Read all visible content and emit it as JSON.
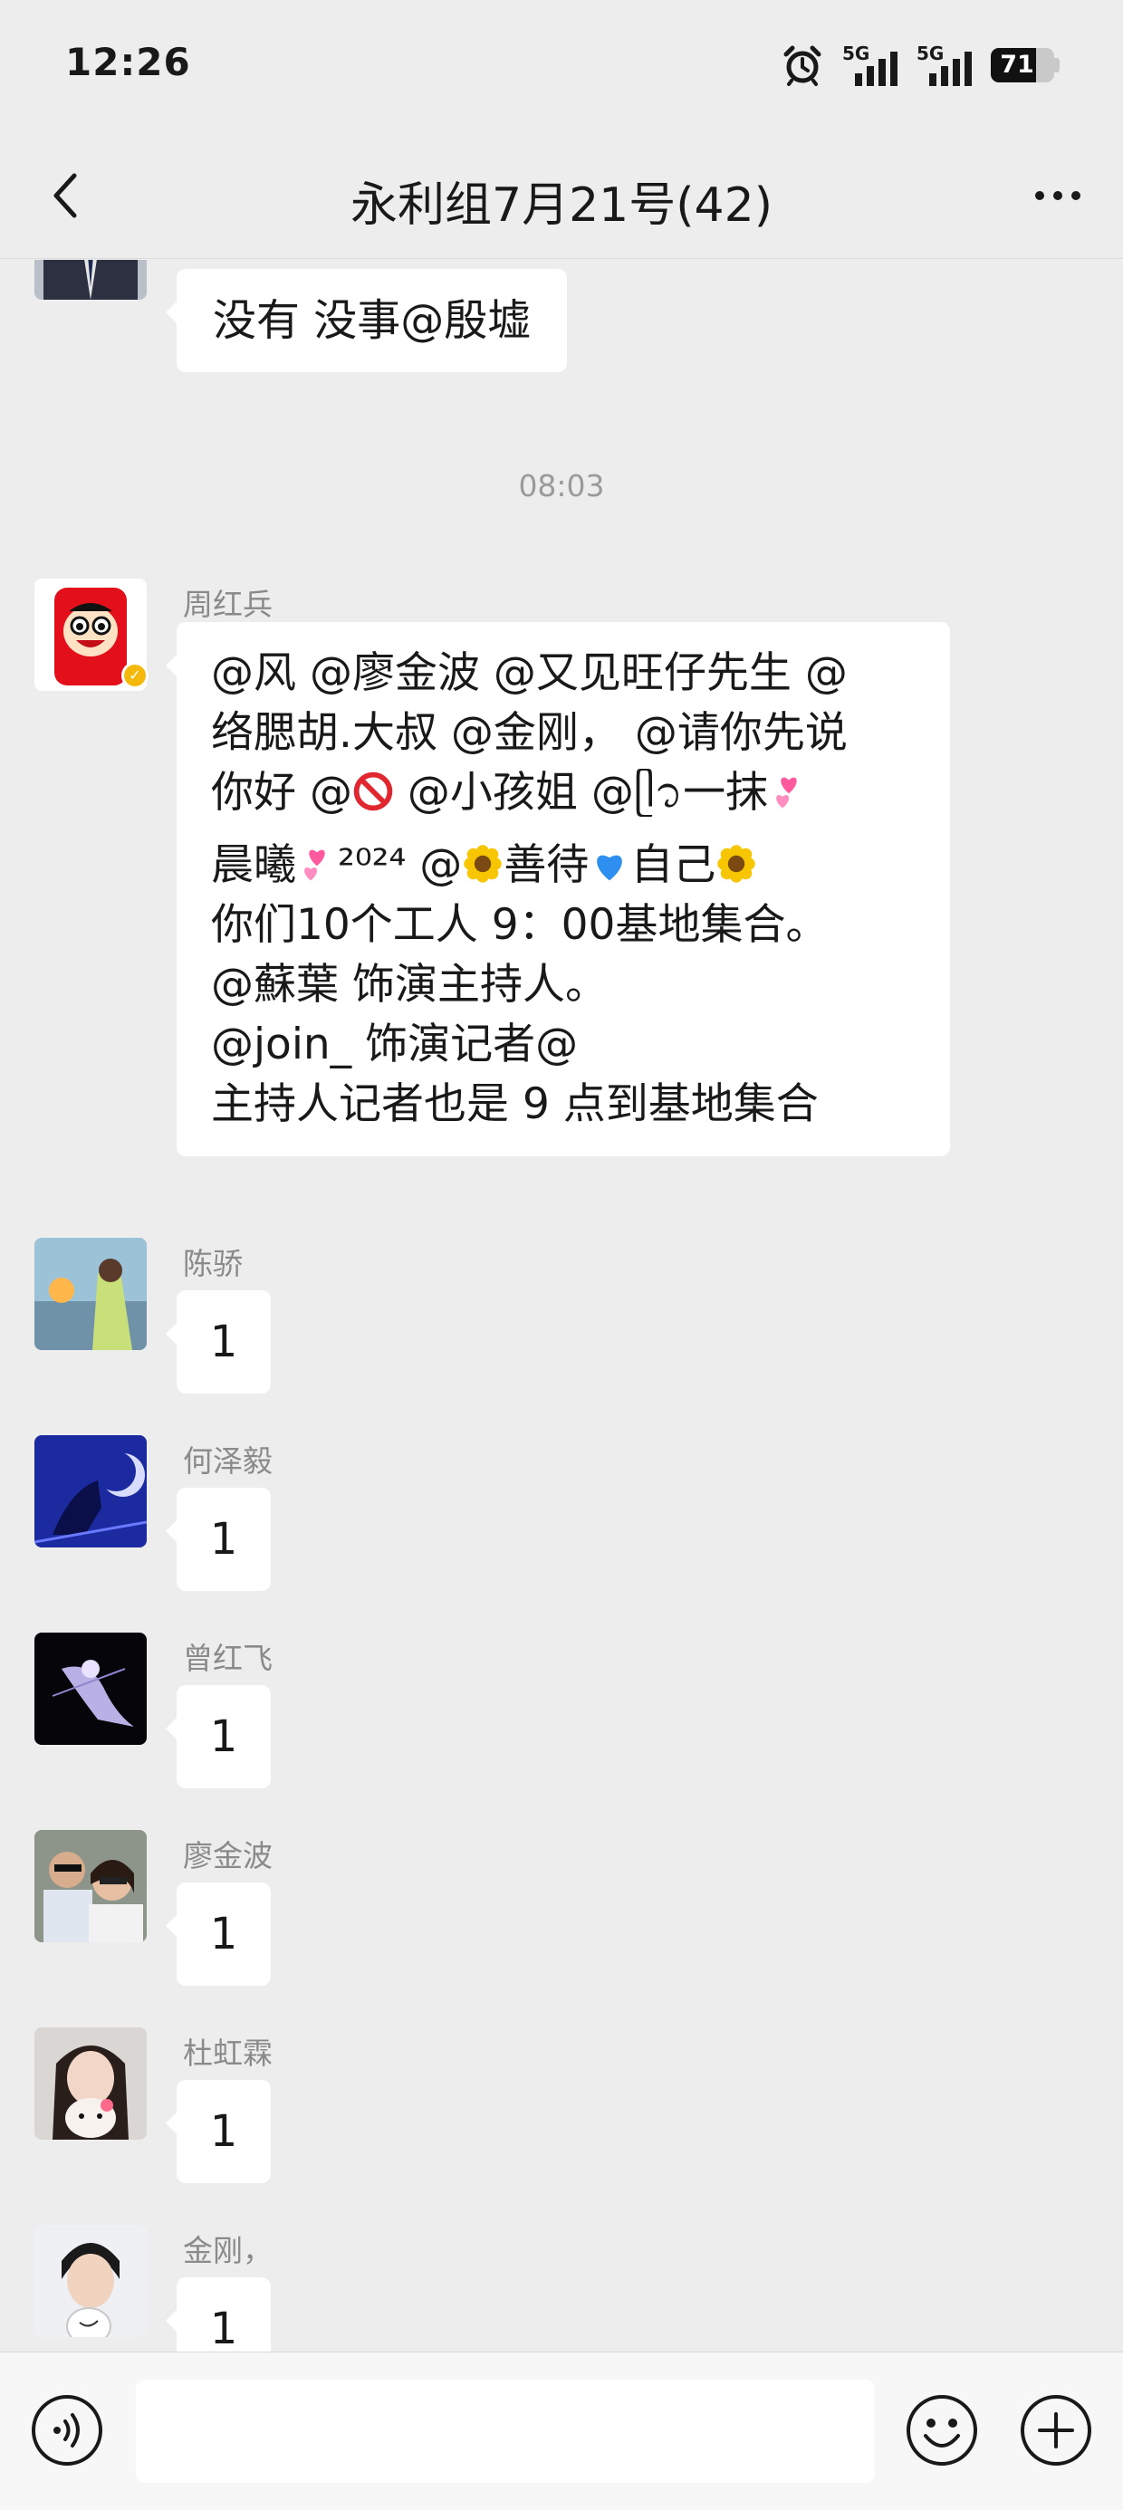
{
  "status_bar": {
    "time": "12:26",
    "net_1": "5G",
    "net_2": "5G",
    "battery": "71",
    "battery_level": 0.71,
    "icons": [
      "alarm-icon",
      "signal-icon",
      "signal-icon",
      "battery-icon"
    ]
  },
  "header": {
    "title": "永利组7月21号(42)",
    "back_icon": "chevron-left-icon",
    "more_icon": "more-icon"
  },
  "messages": [
    {
      "sender": "",
      "text": "没有 没事@殷墟"
    },
    {
      "timestamp": "08:03"
    },
    {
      "sender": "周红兵",
      "lines": {
        "l1": "@风 @廖金波 @又见旺仔先生 @",
        "l2": "络腮胡.大叔 @金刚， @请你先说",
        "l3a": "你好 @",
        "l3b": " @小孩姐 @ᥫ᭡一抹",
        "l4a": "晨曦",
        "l4b": "²⁰²⁴ @",
        "l4c": "善待",
        "l4d": "自己",
        "l5": "你们10个工人 9：00基地集合。",
        "l6": "@蘇葉 饰演主持人。",
        "l7": "@join_ 饰演记者@",
        "l8": "主持人记者也是 9 点到基地集合"
      },
      "emoji_names": [
        "prohibited-emoji",
        "two-hearts-emoji",
        "sunflower-emoji",
        "blue-heart-emoji"
      ]
    },
    {
      "sender": "陈骄",
      "text": "1"
    },
    {
      "sender": "何泽毅",
      "text": "1"
    },
    {
      "sender": "曾红飞",
      "text": "1"
    },
    {
      "sender": "廖金波",
      "text": "1"
    },
    {
      "sender": "杜虹霖",
      "text": "1"
    },
    {
      "sender": "金刚，",
      "text": "1"
    }
  ],
  "input_bar": {
    "placeholder": "",
    "icons": [
      "voice-icon",
      "emoji-icon",
      "plus-icon"
    ]
  },
  "colors": {
    "background": "#ededed",
    "bubble": "#ffffff",
    "verified_badge": "#f5b90d"
  }
}
